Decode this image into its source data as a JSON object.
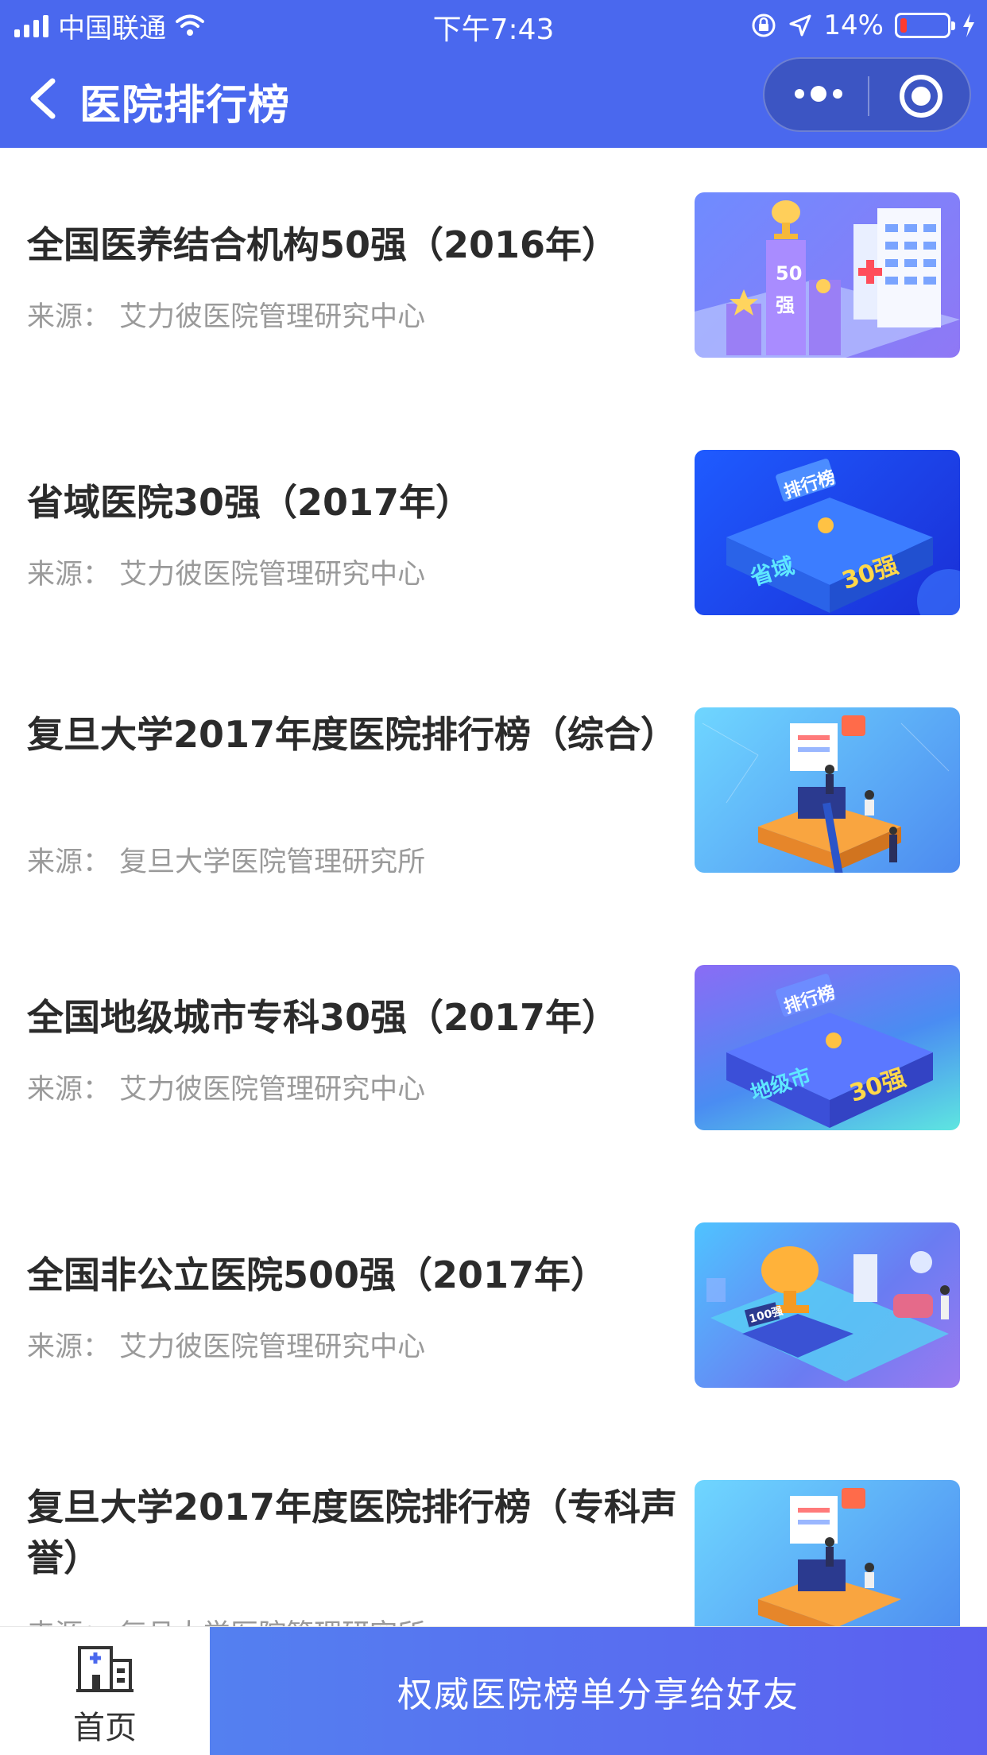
{
  "status_bar": {
    "carrier": "中国联通",
    "time": "下午7:43",
    "battery_percent": "14%",
    "battery_level": 0.14
  },
  "nav": {
    "title": "医院排行榜"
  },
  "items": [
    {
      "title": "全国医养结合机构50强（2016年）",
      "source": "来源：  艾力彼医院管理研究中心",
      "thumb_text": [
        "50",
        "强"
      ]
    },
    {
      "title": "省域医院30强（2017年）",
      "source": "来源：  艾力彼医院管理研究中心",
      "thumb_text": [
        "排行榜",
        "省域",
        "30强"
      ]
    },
    {
      "title": "复旦大学2017年度医院排行榜（综合）",
      "source": "来源：  复旦大学医院管理研究所",
      "thumb_text": []
    },
    {
      "title": "全国地级城市专科30强（2017年）",
      "source": "来源：  艾力彼医院管理研究中心",
      "thumb_text": [
        "排行榜",
        "地级市",
        "30强"
      ]
    },
    {
      "title": "全国非公立医院500强（2017年）",
      "source": "来源：  艾力彼医院管理研究中心",
      "thumb_text": [
        "100强"
      ]
    },
    {
      "title": "复旦大学2017年度医院排行榜（专科声誉）",
      "source": "来源：  复旦大学医院管理研究所",
      "thumb_text": []
    }
  ],
  "bottom_bar": {
    "home_label": "首页",
    "share_label": "权威医院榜单分享给好友"
  },
  "colors": {
    "brand": "#4a68ee",
    "share_start": "#5480f0",
    "share_end": "#5b5ff0"
  }
}
